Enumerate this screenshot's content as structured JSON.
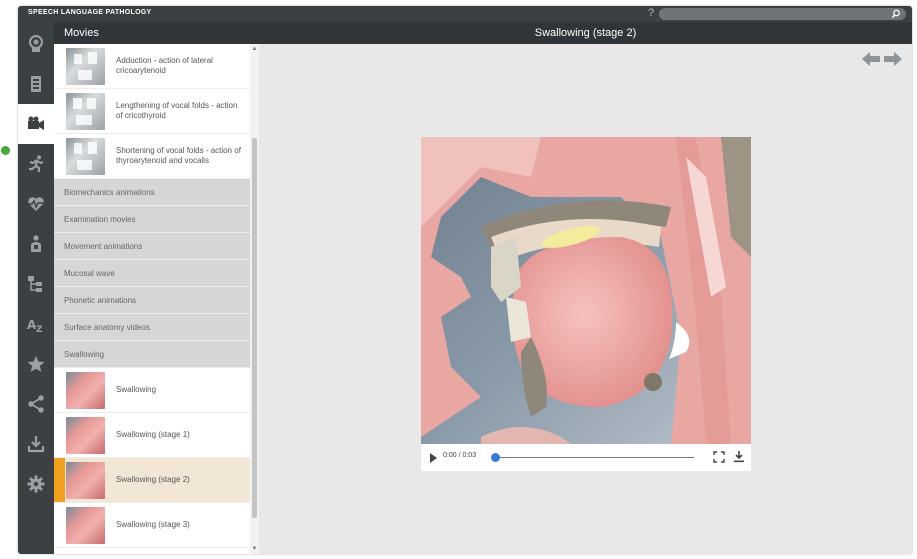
{
  "app": {
    "title": "SPEECH LANGUAGE PATHOLOGY",
    "help": "?"
  },
  "search": {
    "placeholder": ""
  },
  "rail": [
    "head-icon",
    "cabinet-icon",
    "video-camera-icon",
    "running-person-icon",
    "heartbeat-icon",
    "body-icon",
    "tree-icon",
    "az-index-icon",
    "star-icon",
    "share-icon",
    "download-icon",
    "gear-icon"
  ],
  "panel": {
    "title": "Movies"
  },
  "top_movies": [
    {
      "label": "Adduction - action of lateral cricoarytenoid"
    },
    {
      "label": "Lengthening of vocal folds - action of cricothyroid"
    },
    {
      "label": "Shortening of vocal folds - action of thyroarytenoid and vocalis"
    }
  ],
  "categories": [
    "Biomechanics animations",
    "Examination movies",
    "Movement animations",
    "Mucosal wave",
    "Phonetic animations",
    "Surface anatomy videos",
    "Swallowing"
  ],
  "swallowing_movies": [
    {
      "label": "Swallowing"
    },
    {
      "label": "Swallowing (stage 1)"
    },
    {
      "label": "Swallowing (stage 2)"
    },
    {
      "label": "Swallowing (stage 3)"
    }
  ],
  "main": {
    "title": "Swallowing (stage 2)"
  },
  "player": {
    "time": "0:00 / 0:03",
    "progress": 0
  },
  "colors": {
    "accent": "#f0a020",
    "status": "#47a83c",
    "knob": "#3a78d8"
  }
}
